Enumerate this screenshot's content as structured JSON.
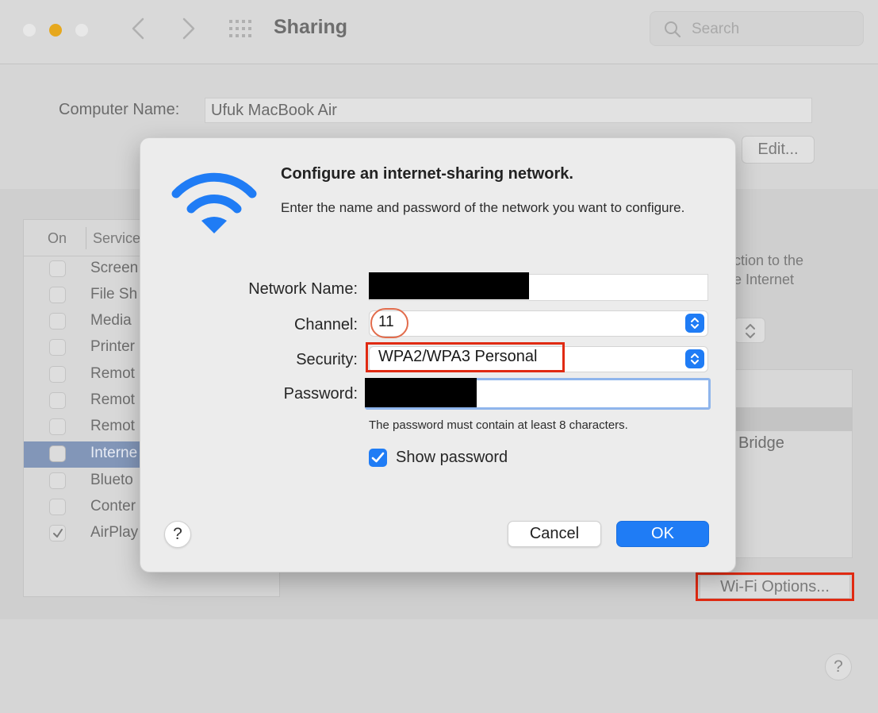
{
  "window": {
    "title": "Sharing",
    "search_placeholder": "Search"
  },
  "background": {
    "computer_name_label": "Computer Name:",
    "computer_name_value": "Ufuk MacBook Air",
    "edit_button": "Edit...",
    "services_header_on": "On",
    "services_header_service": "Service",
    "services": [
      {
        "label": "Screen",
        "checked": false,
        "selected": false
      },
      {
        "label": "File Sh",
        "checked": false,
        "selected": false
      },
      {
        "label": "Media",
        "checked": false,
        "selected": false
      },
      {
        "label": "Printer",
        "checked": false,
        "selected": false
      },
      {
        "label": "Remot",
        "checked": false,
        "selected": false
      },
      {
        "label": "Remot",
        "checked": false,
        "selected": false
      },
      {
        "label": "Remot",
        "checked": false,
        "selected": false
      },
      {
        "label": "Interne",
        "checked": false,
        "selected": true
      },
      {
        "label": "Blueto",
        "checked": false,
        "selected": false
      },
      {
        "label": "Conter",
        "checked": false,
        "selected": false
      },
      {
        "label": "AirPlay",
        "checked": true,
        "selected": false
      }
    ],
    "description_fragment": "ction to the\ne Internet",
    "list_item_bridge": "Bridge",
    "wifi_options_button": "Wi-Fi Options...",
    "help_button": "?"
  },
  "dialog": {
    "title": "Configure an internet-sharing network.",
    "description": "Enter the name and password of the network you want to configure.",
    "network_name_label": "Network Name:",
    "channel_label": "Channel:",
    "channel_value": "11",
    "security_label": "Security:",
    "security_value": "WPA2/WPA3 Personal",
    "password_label": "Password:",
    "password_hint": "The password must contain at least 8 characters.",
    "show_password_label": "Show password",
    "show_password_checked": true,
    "help_button": "?",
    "cancel_button": "Cancel",
    "ok_button": "OK"
  },
  "colors": {
    "accent": "#1f7cf5",
    "highlight_red": "#e02a12",
    "wifi_icon": "#1f7cf5"
  }
}
